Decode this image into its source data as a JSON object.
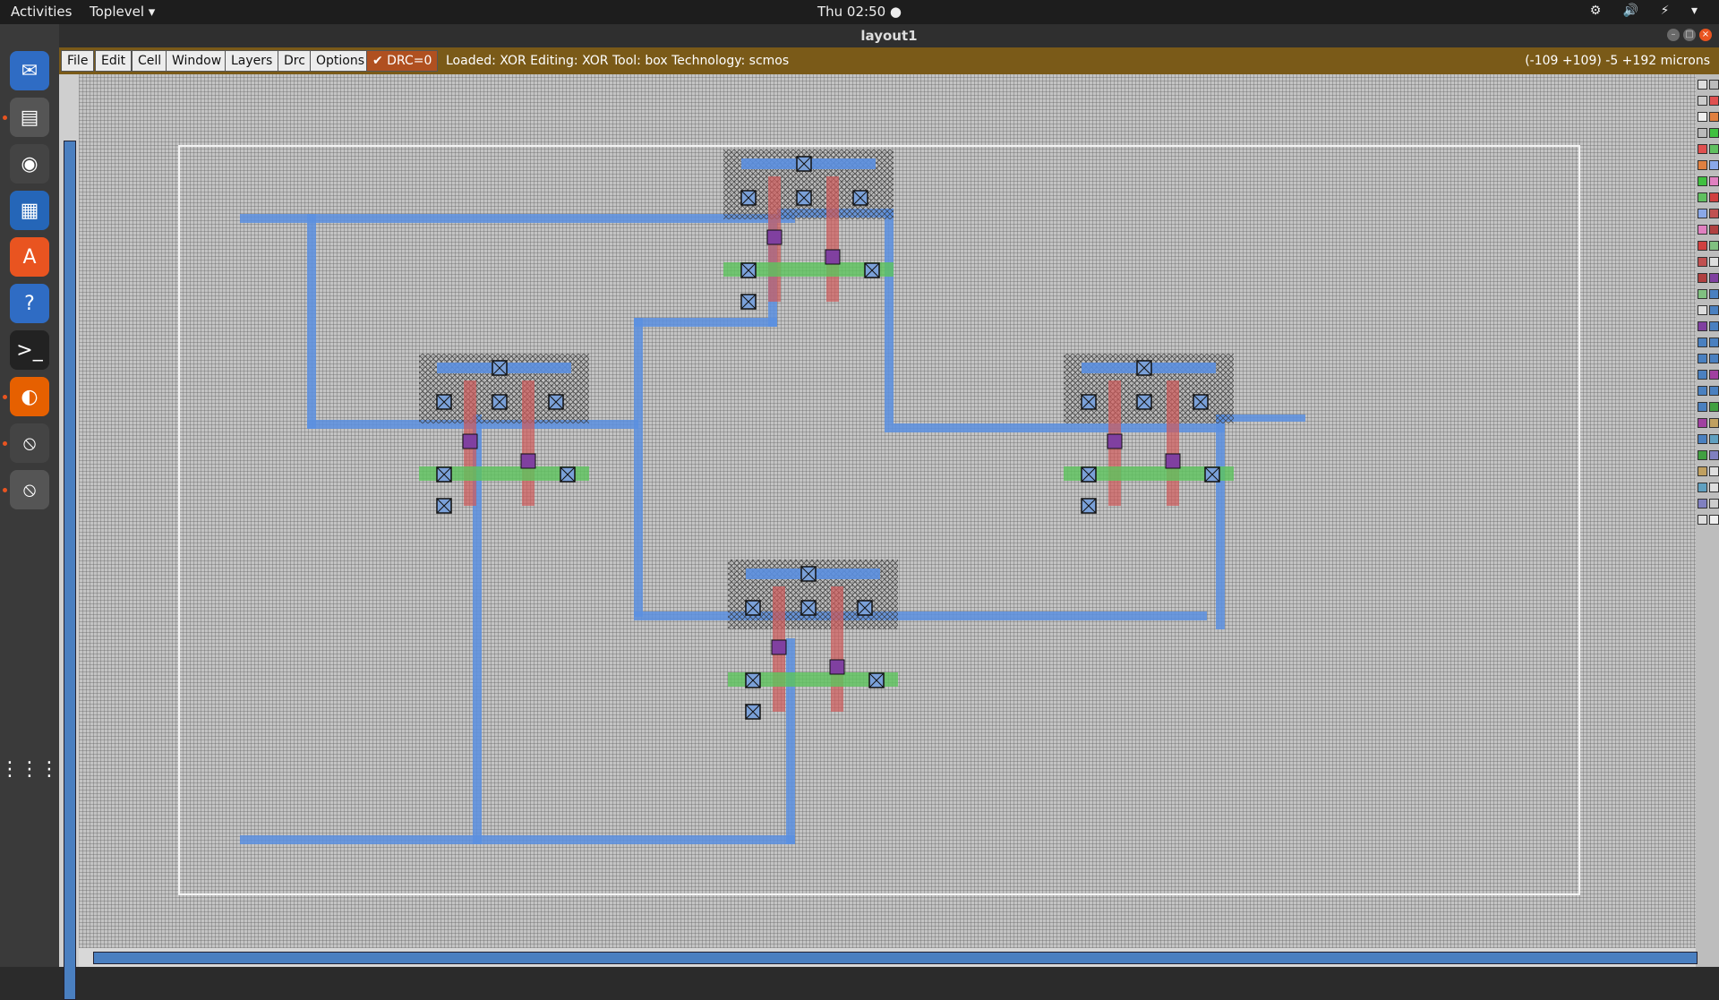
{
  "topbar": {
    "activities": "Activities",
    "app_menu": "Toplevel ▾",
    "clock": "Thu 02:50 ●",
    "tray": "⚙ 🔊 ⚡ ▾"
  },
  "dock": {
    "items": [
      {
        "icon": "thunderbird-icon",
        "glyph": "✉"
      },
      {
        "icon": "files-icon",
        "glyph": "▤"
      },
      {
        "icon": "rhythmbox-icon",
        "glyph": "◉"
      },
      {
        "icon": "writer-icon",
        "glyph": "▦"
      },
      {
        "icon": "software-icon",
        "glyph": "A"
      },
      {
        "icon": "help-icon",
        "glyph": "?"
      },
      {
        "icon": "terminal-icon",
        "glyph": ">_"
      },
      {
        "icon": "firefox-icon",
        "glyph": "◐"
      },
      {
        "icon": "magic-icon",
        "glyph": "⦸"
      },
      {
        "icon": "magic-active-icon",
        "glyph": "⦸"
      }
    ],
    "apps_grid": "⋮⋮⋮"
  },
  "window": {
    "title": "layout1"
  },
  "menubar": {
    "items": [
      "File",
      "Edit",
      "Cell",
      "Window",
      "Layers",
      "Drc",
      "Options"
    ],
    "drc": "✔ DRC=0",
    "status": "Loaded: XOR  Editing: XOR  Tool: box   Technology: scmos",
    "coords": "(-109 +109) -5 +192 microns"
  },
  "colors": {
    "metal": "#5b8fe0",
    "poly": "#d05a5a",
    "diffusion": "#5cc45c",
    "contact": "#1a1a1a",
    "label": "#e8e000",
    "menubar": "#7a5a18"
  }
}
